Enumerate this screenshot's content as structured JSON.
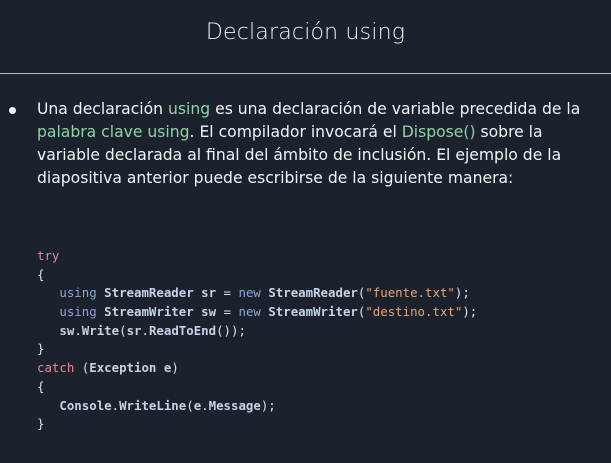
{
  "slide": {
    "title": "Declaración using"
  },
  "bullet": {
    "t1": "Una declaración ",
    "h1": "using",
    "t2": " es una declaración de variable precedida de la ",
    "h2": "palabra clave using",
    "t3": ". El compilador invocará el ",
    "h3": "Dispose()",
    "t4": " sobre la variable declarada al final del ámbito de inclusión. El ejemplo de la diapositiva anterior puede escribirse de la siguiente manera:"
  },
  "code": {
    "l1": {
      "kw": "try"
    },
    "l2": {
      "p": "{"
    },
    "l3": {
      "indent": "   ",
      "kw": "using",
      "sp1": " ",
      "type1": "StreamReader",
      "sp2": " ",
      "var": "sr",
      "eq": " = ",
      "kw2": "new",
      "sp3": " ",
      "type2": "StreamReader",
      "open": "(",
      "str": "\"fuente.txt\"",
      "close": ");"
    },
    "l4": {
      "indent": "   ",
      "kw": "using",
      "sp1": " ",
      "type1": "StreamWriter",
      "sp2": " ",
      "var": "sw",
      "eq": " = ",
      "kw2": "new",
      "sp3": " ",
      "type2": "StreamWriter",
      "open": "(",
      "str": "\"destino.txt\"",
      "close": ");"
    },
    "l5": {
      "indent": "   ",
      "id1": "sw",
      "dot1": ".",
      "id2": "Write",
      "open": "(",
      "id3": "sr",
      "dot2": ".",
      "id4": "ReadToEnd",
      "close": "());"
    },
    "l6": {
      "p": "}"
    },
    "l7": {
      "kw": "catch",
      "sp": " (",
      "type": "Exception",
      "sp2": " ",
      "var": "e",
      "close": ")"
    },
    "l8": {
      "p": "{"
    },
    "l9": {
      "indent": "   ",
      "id1": "Console",
      "dot1": ".",
      "id2": "WriteLine",
      "open": "(",
      "id3": "e",
      "dot2": ".",
      "id4": "Message",
      "close": ");"
    },
    "l10": {
      "p": "}"
    }
  },
  "colors": {
    "background": "#1b222d",
    "text": "#f2f4f7",
    "highlight": "#8fd3a3",
    "keyword": "#e58f93",
    "string": "#e6a572"
  }
}
